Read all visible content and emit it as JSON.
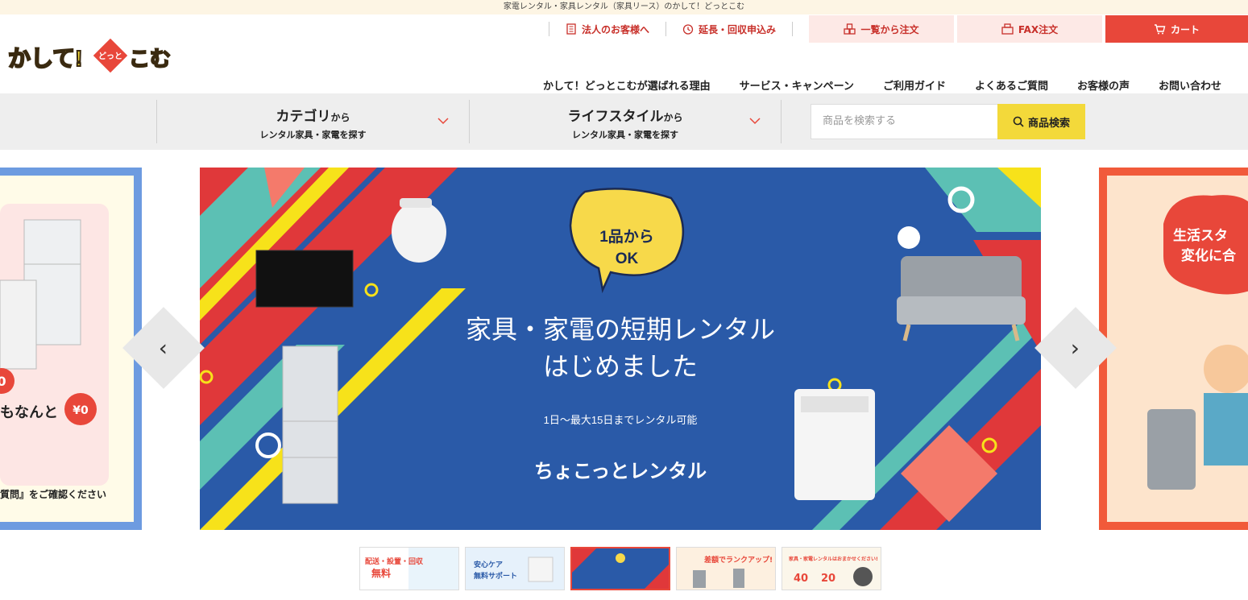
{
  "topbar": {
    "text": "家電レンタル・家具レンタル（家具リース）のかして！どっとこむ"
  },
  "logo": {
    "text_main": "かして!",
    "text_mid": "どっと",
    "text_end": "こむ"
  },
  "util_links": [
    {
      "label": "法人のお客様へ",
      "icon": "building-icon"
    },
    {
      "label": "延長・回収申込み",
      "icon": "clock-icon"
    }
  ],
  "util_buttons": {
    "list": "一覧から注文",
    "fax": "FAX注文",
    "cart": "カート"
  },
  "gnav": [
    "かして！どっとこむが選ばれる理由",
    "サービス・キャンペーン",
    "ご利用ガイド",
    "よくあるご質問",
    "お客様の声",
    "お問い合わせ"
  ],
  "search": {
    "category_title": "カテゴリ",
    "category_from": "から",
    "category_sub": "レンタル家具・家電を探す",
    "life_title": "ライフスタイル",
    "life_from": "から",
    "life_sub": "レンタル家具・家電を探す",
    "placeholder": "商品を検索する",
    "button": "商品検索"
  },
  "banner": {
    "bubble_line1": "1品から",
    "bubble_line2": "OK",
    "headline1": "家具・家電の短期レンタル",
    "headline2": "はじめました",
    "sub": "1日〜最大15日までレンタル可能",
    "brand": "ちょこっとレンタル"
  },
  "left_slide": {
    "price1": "0",
    "text": "もなんと",
    "price2": "¥0",
    "footer": "質問』をご確認ください"
  },
  "right_slide": {
    "bubble": "生活スタ\n変化に合"
  },
  "thumbs": [
    {
      "label": "配送・設置・回収 無料"
    },
    {
      "label": "安心ケア 無料サポート"
    },
    {
      "label": "家具・家電の短期レンタル"
    },
    {
      "label": "差額でランクアップ"
    },
    {
      "label": "家具・家電レンタルはおまかせください"
    }
  ],
  "thumb_texts": {
    "t1a": "配送・設置・回収",
    "t1b": "無料",
    "t2a": "安心ケア",
    "t2b": "無料サポート",
    "t4": "差額でランクアップ!",
    "t5a": "家具・家電レンタルはおまかせください!",
    "t5b": "40",
    "t5c": "20"
  },
  "arrows": {
    "prev": "‹",
    "next": "›"
  },
  "colors": {
    "accent": "#e8473a",
    "yellow": "#f3d93a",
    "blue": "#2a5aa8"
  }
}
